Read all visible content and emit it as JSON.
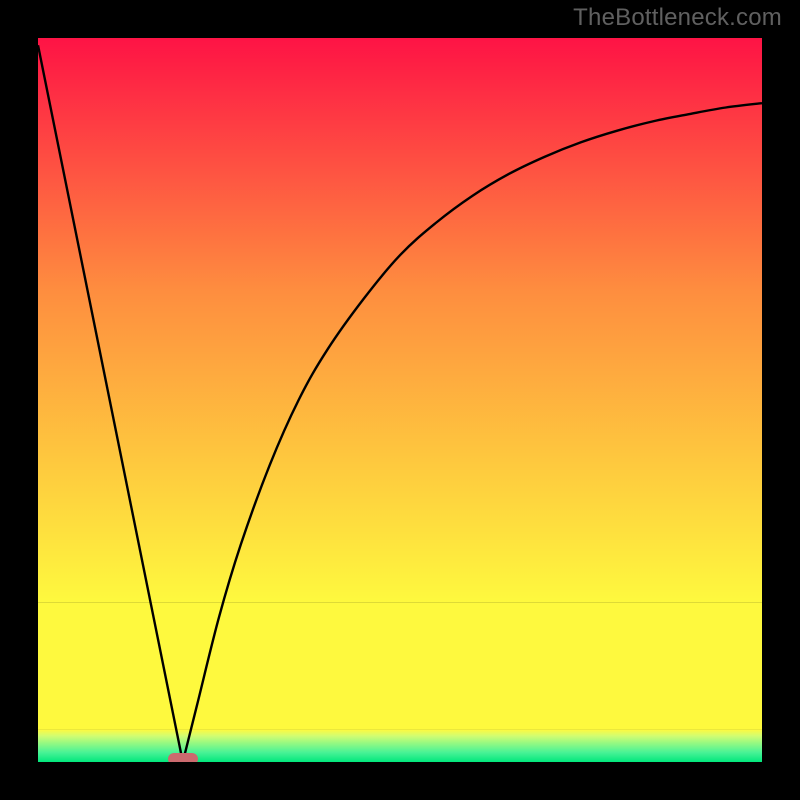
{
  "attribution": "TheBottleneck.com",
  "colors": {
    "top": "#fe1345",
    "mid_upper": "#fe8e3f",
    "mid_lower": "#fef93e",
    "green_pale": "#b2fd8c",
    "green": "#01e77c",
    "black": "#000000",
    "marker": "#cb6a6e",
    "curve": "#000000"
  },
  "chart_data": {
    "type": "line",
    "title": "",
    "xlabel": "",
    "ylabel": "",
    "xlim": [
      0,
      100
    ],
    "ylim": [
      0,
      100
    ],
    "notch_x": 20,
    "left_line": {
      "x": [
        0,
        20
      ],
      "y": [
        99,
        0
      ]
    },
    "right_curve_x": [
      20,
      22,
      25,
      28,
      32,
      36,
      40,
      45,
      50,
      55,
      60,
      65,
      70,
      75,
      80,
      85,
      90,
      95,
      100
    ],
    "right_curve_y": [
      0,
      8,
      20,
      30,
      41,
      50,
      57,
      64,
      70,
      74.5,
      78.2,
      81.2,
      83.6,
      85.6,
      87.2,
      88.5,
      89.5,
      90.4,
      91
    ],
    "marker": {
      "x_center": 20,
      "width_pct": 4.2,
      "y": 0
    },
    "green_band_top_y": 4.5,
    "yellow_band_top_y": 22
  }
}
